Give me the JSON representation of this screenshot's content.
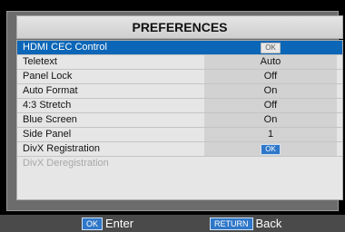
{
  "title": "PREFERENCES",
  "menu": [
    {
      "label": "HDMI CEC Control",
      "value": "OK"
    },
    {
      "label": "Teletext",
      "value": "Auto"
    },
    {
      "label": "Panel Lock",
      "value": "Off"
    },
    {
      "label": "Auto Format",
      "value": "On"
    },
    {
      "label": "4:3 Stretch",
      "value": "Off"
    },
    {
      "label": "Blue Screen",
      "value": "On"
    },
    {
      "label": "Side Panel",
      "value": "1"
    },
    {
      "label": "DivX Registration",
      "value": "OK"
    },
    {
      "label": "DivX Deregistration",
      "value": ""
    }
  ],
  "footer": {
    "ok_key": "OK",
    "ok_label": "Enter",
    "return_key": "RETURN",
    "return_label": "Back"
  },
  "colors": {
    "highlight": "#0b66b7",
    "key_button": "#2f77c8"
  }
}
